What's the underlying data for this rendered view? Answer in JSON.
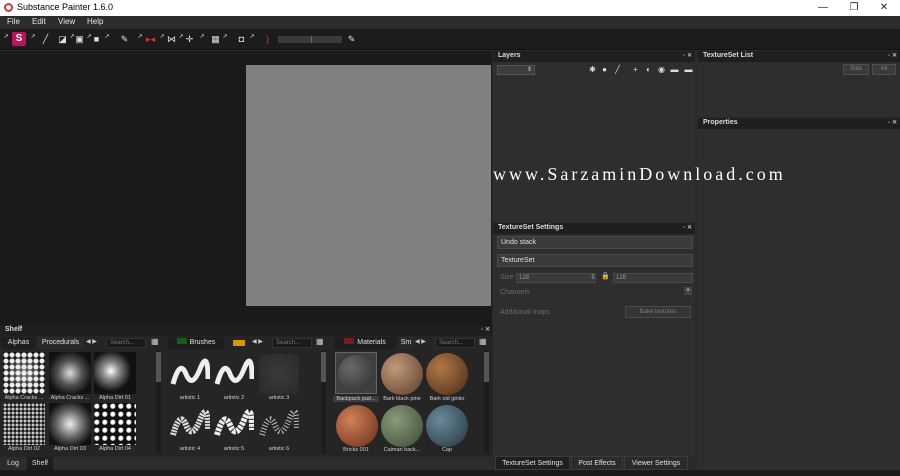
{
  "window": {
    "title": "Substance Painter 1.6.0",
    "minimize": "—",
    "maximize": "❐",
    "close": "✕"
  },
  "menu": [
    "File",
    "Edit",
    "View",
    "Help"
  ],
  "toolbar": {
    "logo": "S"
  },
  "layers": {
    "title": "Layers",
    "dropdown_value": "⇕"
  },
  "textureset_list": {
    "title": "TextureSet List",
    "solo_label": "Solo",
    "all_label": "All"
  },
  "properties": {
    "title": "Properties"
  },
  "watermark": "www.SarzaminDownload.com",
  "textureset_settings": {
    "title": "TextureSet Settings",
    "undo_stack": "Undo stack",
    "textureset": "TextureSet",
    "size_label": "Size",
    "size_w": "128",
    "size_h": "128",
    "channels_label": "Channels",
    "additional_maps_label": "Additional maps",
    "bake_label": "Bake textures"
  },
  "right_tabs": [
    "TextureSet Settings",
    "Post Effects",
    "Viewer Settings"
  ],
  "shelf": {
    "title": "Shelf",
    "search_placeholder": "Search...",
    "tabs_left": [
      "Alphas",
      "Procedurals"
    ],
    "tab_brushes": "Brushes",
    "tab_materials": "Materials",
    "tab_sm": "Sm",
    "alphas": [
      "Alpha Cracks ...",
      "Alpha Cracks ...",
      "Alpha Dirt 01",
      "Alpha Dirt 02",
      "Alpha Dirt 03",
      "Alpha Dirt 04"
    ],
    "brushes": [
      "artistic 1",
      "artistic 2",
      "artistic 3",
      "artistic 4",
      "artistic 5",
      "artistic 6"
    ],
    "materials": [
      "Backpack pad...",
      "Bark black pine",
      "Bark old ginko",
      "Bricks 001",
      "Caiman back...",
      "Cap"
    ]
  },
  "status_tabs": [
    "Log",
    "Shelf"
  ]
}
